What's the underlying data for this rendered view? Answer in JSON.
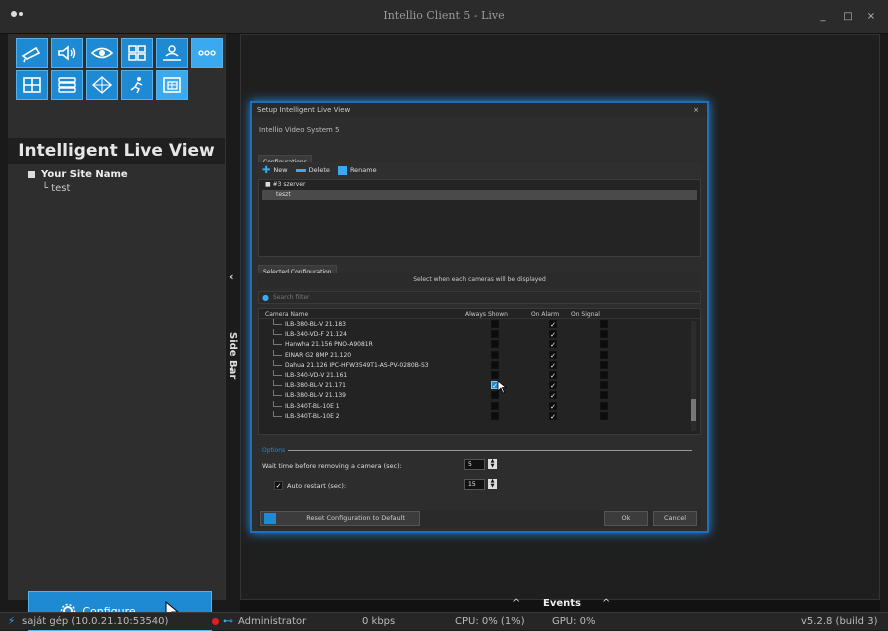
{
  "window": {
    "title": "Intellio Client 5 - Live",
    "buttons": [
      "_",
      "□",
      "×"
    ]
  },
  "sidebar": {
    "toolbar_row1_icons": [
      "camera-icon",
      "speaker-icon",
      "eye-icon",
      "layout-grid-icon",
      "user-map-icon",
      "more-icon"
    ],
    "toolbar_row2_icons": [
      "grid-view-icon",
      "list-view-icon",
      "tree-view-icon",
      "motion-icon",
      "intelligent-view-icon"
    ],
    "title": "Intelligent Live View",
    "tree": {
      "site": "Your Site Name",
      "leaf": "test"
    },
    "configure_label": "Configure"
  },
  "sidetab": {
    "label": "Side Bar",
    "arrow": "‹"
  },
  "events": {
    "label": "Events",
    "chevron": "^"
  },
  "status": {
    "connection": "saját gép (10.0.21.10:53540)",
    "user": "Administrator",
    "bandwidth": "0 kbps",
    "cpu": "CPU: 0% (1%)",
    "gpu": "GPU: 0%",
    "version": "v5.2.8 (build 3)"
  },
  "dialog": {
    "title": "Setup Intelligent Live View",
    "close": "×",
    "subtitle": "Intellio Video System 5",
    "configurations_tab": "Configurations",
    "toolbar": {
      "new": "New",
      "delete": "Delete",
      "rename": "Rename"
    },
    "config_group": "#3 szerver",
    "config_item": "teszt",
    "selected_tab": "Selected Configuration",
    "hint": "Select when each cameras will be displayed",
    "filter_placeholder": "Search filter",
    "columns": {
      "name": "Camera Name",
      "always": "Always Shown",
      "alarm": "On Alarm",
      "signal": "On Signal"
    },
    "cameras": [
      {
        "name": "ILB-380-BL-V 21.183",
        "always": "",
        "alarm": "✓",
        "signal": ""
      },
      {
        "name": "ILB-340-VD-F 21.124",
        "always": "",
        "alarm": "✓",
        "signal": ""
      },
      {
        "name": "Hanwha 21.156  PNO-A9081R",
        "always": "",
        "alarm": "✓",
        "signal": ""
      },
      {
        "name": "EINAR G2 8MP 21.120",
        "always": "",
        "alarm": "✓",
        "signal": ""
      },
      {
        "name": "Dahua 21.126 IPC-HFW3549T1-AS-PV-0280B-S3",
        "always": "",
        "alarm": "✓",
        "signal": ""
      },
      {
        "name": "ILB-340-VD-V 21.161",
        "always": "",
        "alarm": "✓",
        "signal": ""
      },
      {
        "name": "ILB-380-BL-V 21.171",
        "always": "✓",
        "alarm": "✓",
        "signal": ""
      },
      {
        "name": "ILB-380-BL-V 21.139",
        "always": "",
        "alarm": "✓",
        "signal": ""
      },
      {
        "name": "ILB-340T-BL-10E 1",
        "always": "",
        "alarm": "✓",
        "signal": ""
      },
      {
        "name": "ILB-340T-BL-10E 2",
        "always": "",
        "alarm": "✓",
        "signal": ""
      }
    ],
    "options_label": "Options",
    "wait_label": "Wait time before removing a camera (sec):",
    "wait_value": "5",
    "auto_restart_label": "Auto restart (sec):",
    "auto_restart_value": "15",
    "auto_restart_checked": "✓",
    "reset_label": "Reset Configuration to Default",
    "ok_label": "Ok",
    "cancel_label": "Cancel"
  }
}
